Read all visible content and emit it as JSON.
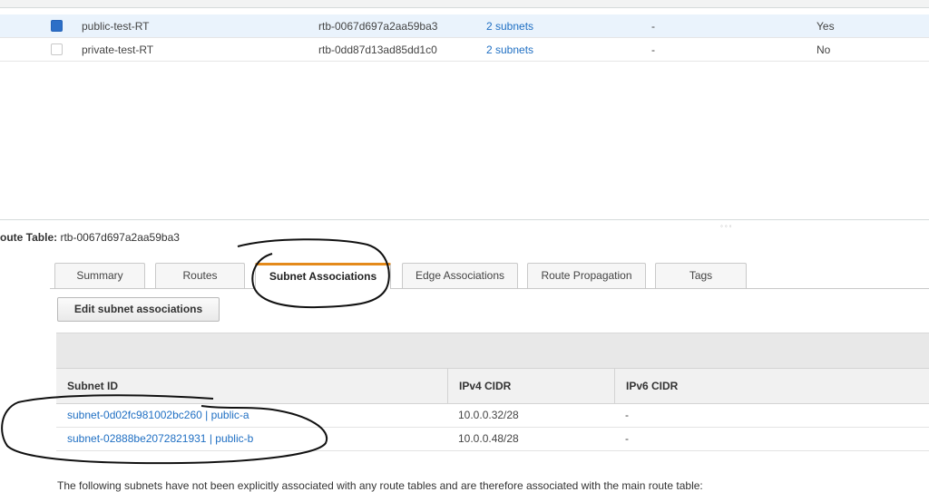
{
  "route_tables": {
    "rows": [
      {
        "name": "public-test-RT",
        "route_table_id": "rtb-0067d697a2aa59ba3",
        "explicit_subnet": "2 subnets",
        "edge": "-",
        "main": "Yes",
        "selected": true
      },
      {
        "name": "private-test-RT",
        "route_table_id": "rtb-0dd87d13ad85dd1c0",
        "explicit_subnet": "2 subnets",
        "edge": "-",
        "main": "No",
        "selected": false
      }
    ]
  },
  "details": {
    "label": "oute Table:",
    "route_table_id": "rtb-0067d697a2aa59ba3"
  },
  "tabs": [
    {
      "label": "Summary"
    },
    {
      "label": "Routes"
    },
    {
      "label": "Subnet Associations",
      "active": true
    },
    {
      "label": "Edge Associations"
    },
    {
      "label": "Route Propagation"
    },
    {
      "label": "Tags"
    }
  ],
  "edit_button": "Edit subnet associations",
  "subnet_table": {
    "columns": [
      "Subnet ID",
      "IPv4 CIDR",
      "IPv6 CIDR"
    ],
    "rows": [
      {
        "subnet": "subnet-0d02fc981002bc260 | public-a",
        "ipv4": "10.0.0.32/28",
        "ipv6": "-"
      },
      {
        "subnet": "subnet-02888be2072821931 | public-b",
        "ipv4": "10.0.0.48/28",
        "ipv6": "-"
      }
    ]
  },
  "footnote": "The following subnets have not been explicitly associated with any route tables and are therefore associated with the main route table:",
  "colors": {
    "accent": "#e48a1b",
    "link": "#1f6fc3",
    "checkbox": "#2d6fc7",
    "annotation": "#111111"
  }
}
